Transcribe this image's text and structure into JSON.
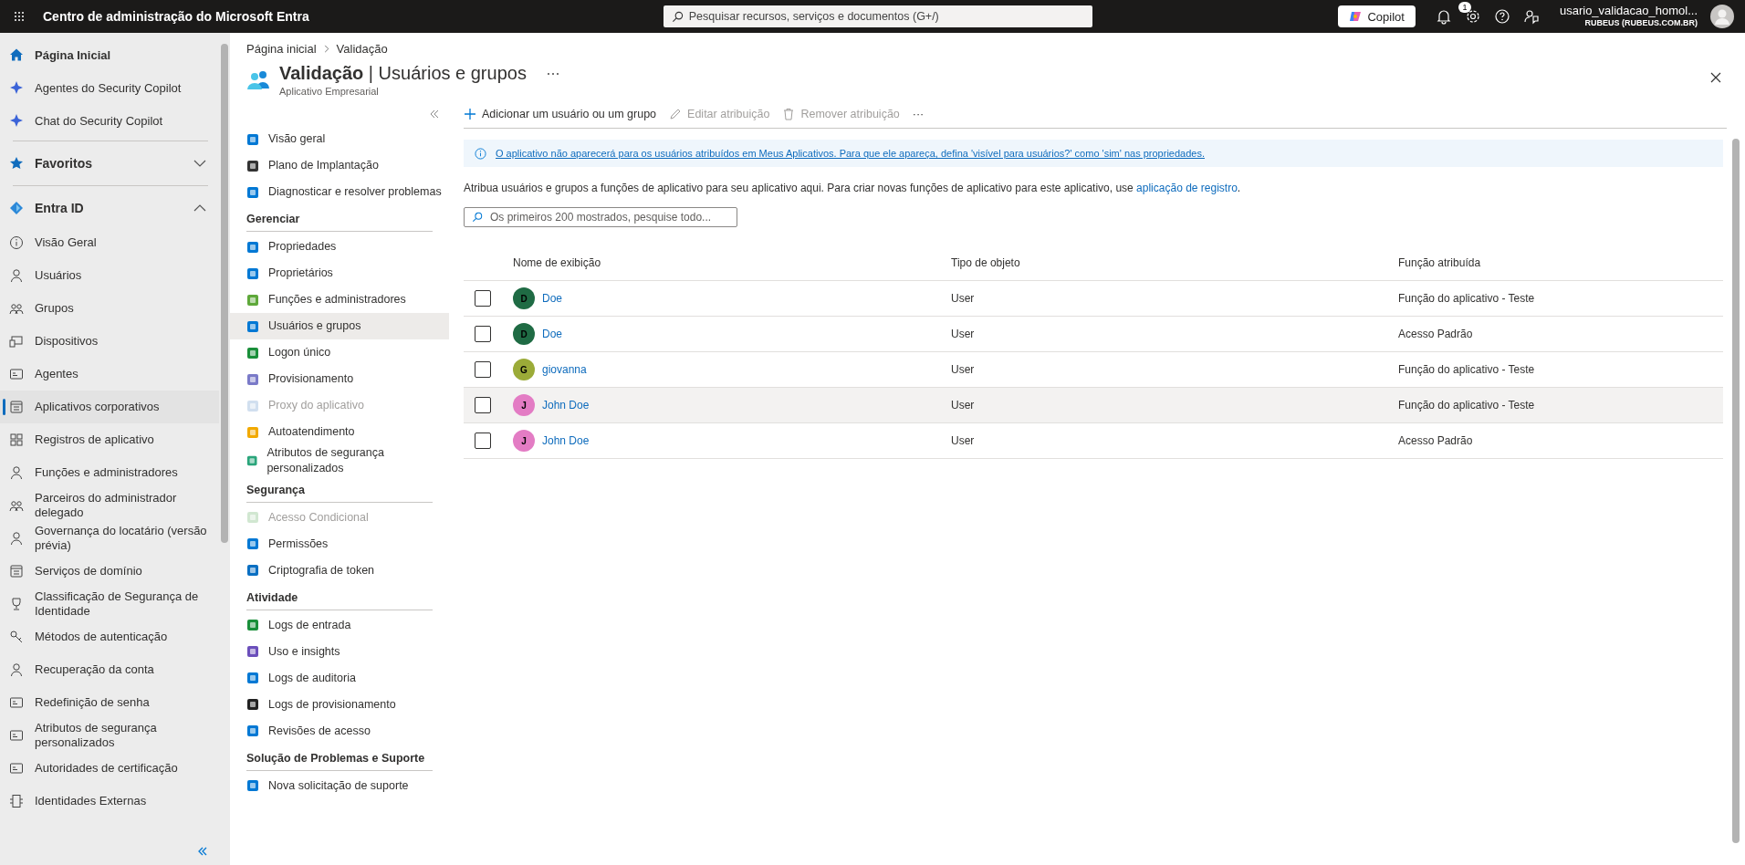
{
  "top_bar": {
    "title": "Centro de administração do Microsoft Entra",
    "search_placeholder": "Pesquisar recursos, serviços e documentos (G+/)",
    "copilot": "Copilot",
    "notification_count": "1",
    "user_name": "usario_validacao_homol...",
    "tenant": "RUBEUS (RUBEUS.COM.BR)"
  },
  "sidebar": {
    "items": [
      {
        "kind": "top",
        "label": "Página Inicial",
        "selected": false
      },
      {
        "kind": "top",
        "label": "Agentes do Security Copilot",
        "selected": false
      },
      {
        "kind": "top",
        "label": "Chat do Security Copilot",
        "selected": false
      },
      {
        "kind": "section",
        "label": "Favoritos",
        "expanded": false
      },
      {
        "kind": "section",
        "label": "Entra ID",
        "expanded": true
      },
      {
        "kind": "link",
        "label": "Visão Geral",
        "selected": false
      },
      {
        "kind": "link",
        "label": "Usuários",
        "selected": false
      },
      {
        "kind": "link",
        "label": "Grupos",
        "selected": false
      },
      {
        "kind": "link",
        "label": "Dispositivos",
        "selected": false
      },
      {
        "kind": "link",
        "label": "Agentes",
        "selected": false
      },
      {
        "kind": "link",
        "label": "Aplicativos corporativos",
        "selected": true
      },
      {
        "kind": "link",
        "label": "Registros de aplicativo",
        "selected": false
      },
      {
        "kind": "link",
        "label": "Funções e administradores",
        "selected": false
      },
      {
        "kind": "link",
        "label": "Parceiros do administrador delegado",
        "selected": false
      },
      {
        "kind": "link",
        "label": "Governança do locatário (versão prévia)",
        "selected": false
      },
      {
        "kind": "link",
        "label": "Serviços de domínio",
        "selected": false
      },
      {
        "kind": "link",
        "label": "Classificação de Segurança de Identidade",
        "selected": false
      },
      {
        "kind": "link",
        "label": "Métodos de autenticação",
        "selected": false
      },
      {
        "kind": "link",
        "label": "Recuperação da conta",
        "selected": false
      },
      {
        "kind": "link",
        "label": "Redefinição de senha",
        "selected": false
      },
      {
        "kind": "link",
        "label": "Atributos de segurança personalizados",
        "selected": false
      },
      {
        "kind": "link",
        "label": "Autoridades de certificação",
        "selected": false
      },
      {
        "kind": "link",
        "label": "Identidades Externas",
        "selected": false
      }
    ]
  },
  "breadcrumb": [
    "Página inicial",
    "Validação"
  ],
  "page": {
    "title": "Validação",
    "separator": "|",
    "subtitle_part": "Usuários e grupos",
    "caption": "Aplicativo Empresarial"
  },
  "resource_nav": {
    "groups": [
      {
        "items": [
          {
            "label": "Visão geral",
            "selected": false,
            "disabled": false
          },
          {
            "label": "Plano de Implantação",
            "selected": false,
            "disabled": false
          },
          {
            "label": "Diagnosticar e resolver problemas",
            "selected": false,
            "disabled": false
          }
        ]
      },
      {
        "heading": "Gerenciar",
        "items": [
          {
            "label": "Propriedades",
            "selected": false,
            "disabled": false
          },
          {
            "label": "Proprietários",
            "selected": false,
            "disabled": false
          },
          {
            "label": "Funções e administradores",
            "selected": false,
            "disabled": false
          },
          {
            "label": "Usuários e grupos",
            "selected": true,
            "disabled": false
          },
          {
            "label": "Logon único",
            "selected": false,
            "disabled": false
          },
          {
            "label": "Provisionamento",
            "selected": false,
            "disabled": false
          },
          {
            "label": "Proxy do aplicativo",
            "selected": false,
            "disabled": true
          },
          {
            "label": "Autoatendimento",
            "selected": false,
            "disabled": false
          },
          {
            "label": "Atributos de segurança personalizados",
            "selected": false,
            "disabled": false
          }
        ]
      },
      {
        "heading": "Segurança",
        "items": [
          {
            "label": "Acesso Condicional",
            "selected": false,
            "disabled": true
          },
          {
            "label": "Permissões",
            "selected": false,
            "disabled": false
          },
          {
            "label": "Criptografia de token",
            "selected": false,
            "disabled": false
          }
        ]
      },
      {
        "heading": "Atividade",
        "items": [
          {
            "label": "Logs de entrada",
            "selected": false,
            "disabled": false
          },
          {
            "label": "Uso e insights",
            "selected": false,
            "disabled": false
          },
          {
            "label": "Logs de auditoria",
            "selected": false,
            "disabled": false
          },
          {
            "label": "Logs de provisionamento",
            "selected": false,
            "disabled": false
          },
          {
            "label": "Revisões de acesso",
            "selected": false,
            "disabled": false
          }
        ]
      },
      {
        "heading": "Solução de Problemas e Suporte",
        "items": [
          {
            "label": "Nova solicitação de suporte",
            "selected": false,
            "disabled": false
          }
        ]
      }
    ]
  },
  "toolbar": [
    {
      "kind": "add",
      "label": "Adicionar um usuário ou um grupo",
      "disabled": false
    },
    {
      "kind": "edit",
      "label": "Editar atribuição",
      "disabled": true
    },
    {
      "kind": "remove",
      "label": "Remover atribuição",
      "disabled": true
    },
    {
      "kind": "more",
      "label": "···",
      "disabled": false
    }
  ],
  "info_banner": "O aplicativo não aparecerá para os usuários atribuídos em Meus Aplicativos. Para que ele apareça, defina 'visível para usuários?' como 'sim' nas propriedades.",
  "description": {
    "text": "Atribua usuários e grupos a funções de aplicativo para seu aplicativo aqui. Para criar novas funções de aplicativo para este aplicativo, use",
    "link": "aplicação de registro",
    "end": "."
  },
  "search": {
    "placeholder": "Os primeiros 200 mostrados, pesquise todo..."
  },
  "table": {
    "columns": [
      "Nome de exibição",
      "Tipo de objeto",
      "Função atribuída"
    ],
    "rows": [
      {
        "initial": "D",
        "color": "#1f6b44",
        "name": "Doe",
        "type": "User",
        "role": "Função do aplicativo - Teste",
        "checked": false,
        "highlighted": false
      },
      {
        "initial": "D",
        "color": "#1f6b44",
        "name": "Doe",
        "type": "User",
        "role": "Acesso Padrão",
        "checked": false,
        "highlighted": false
      },
      {
        "initial": "G",
        "color": "#9bab38",
        "name": "giovanna",
        "type": "User",
        "role": "Função do aplicativo - Teste",
        "checked": false,
        "highlighted": false
      },
      {
        "initial": "J",
        "color": "#e37cc4",
        "name": "John Doe",
        "type": "User",
        "role": "Função do aplicativo - Teste",
        "checked": false,
        "highlighted": true
      },
      {
        "initial": "J",
        "color": "#e37cc4",
        "name": "John Doe",
        "type": "User",
        "role": "Acesso Padrão",
        "checked": false,
        "highlighted": false
      }
    ]
  }
}
